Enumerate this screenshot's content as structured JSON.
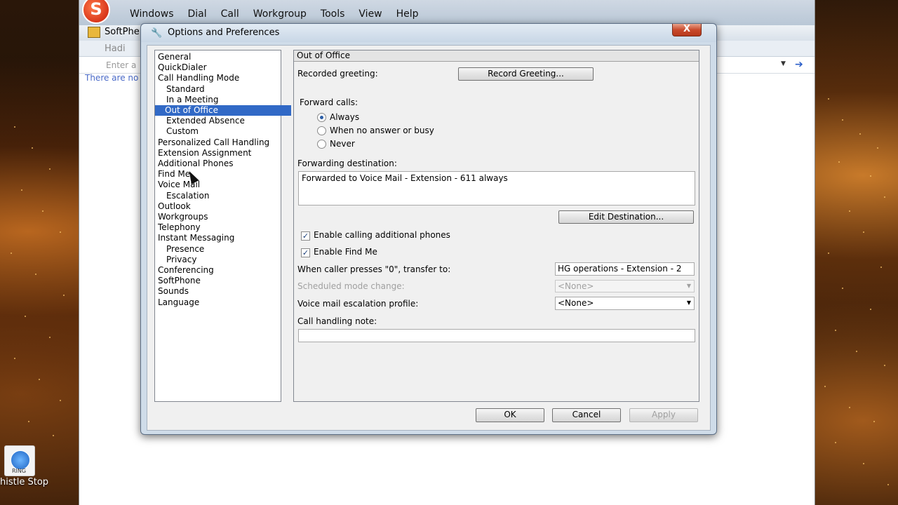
{
  "app": {
    "menu": [
      "Windows",
      "Dial",
      "Call",
      "Workgroup",
      "Tools",
      "View",
      "Help"
    ],
    "toolbar_label": "SoftPhe",
    "user_label": "Hadi",
    "search_placeholder": "Enter a",
    "status_text": "There are no"
  },
  "desktop": {
    "icon_caption": "RING",
    "icon_label": "histle Stop"
  },
  "dialog": {
    "title": "Options and Preferences",
    "close_label": "X",
    "nav": [
      {
        "label": "General"
      },
      {
        "label": "QuickDialer"
      },
      {
        "label": "Call Handling Mode"
      },
      {
        "label": "Standard",
        "sub": true
      },
      {
        "label": "In a Meeting",
        "sub": true
      },
      {
        "label": "Out of Office",
        "sub": true,
        "selected": true
      },
      {
        "label": "Extended Absence",
        "sub": true
      },
      {
        "label": "Custom",
        "sub": true
      },
      {
        "label": "Personalized Call Handling"
      },
      {
        "label": "Extension Assignment"
      },
      {
        "label": "Additional Phones"
      },
      {
        "label": "Find Me"
      },
      {
        "label": "Voice Mail"
      },
      {
        "label": "Escalation",
        "sub": true
      },
      {
        "label": "Outlook"
      },
      {
        "label": "Workgroups"
      },
      {
        "label": "Telephony"
      },
      {
        "label": "Instant Messaging"
      },
      {
        "label": "Presence",
        "sub": true
      },
      {
        "label": "Privacy",
        "sub": true
      },
      {
        "label": "Conferencing"
      },
      {
        "label": "SoftPhone"
      },
      {
        "label": "Sounds"
      },
      {
        "label": "Language"
      }
    ],
    "panel": {
      "header": "Out of Office",
      "recorded_greeting_label": "Recorded greeting:",
      "record_greeting_button": "Record Greeting...",
      "forward_calls_label": "Forward calls:",
      "forward_options": [
        "Always",
        "When no answer or busy",
        "Never"
      ],
      "forward_selected": "Always",
      "forwarding_destination_label": "Forwarding destination:",
      "forwarding_destination_value": "Forwarded to Voice Mail - Extension - 611 always",
      "edit_destination_button": "Edit Destination...",
      "enable_additional_phones_label": "Enable calling additional phones",
      "enable_additional_phones_checked": true,
      "enable_find_me_label": "Enable Find Me",
      "enable_find_me_checked": true,
      "caller_zero_label": "When caller presses \"0\", transfer to:",
      "caller_zero_value": "HG operations - Extension - 2",
      "scheduled_mode_label": "Scheduled mode change:",
      "scheduled_mode_value": "<None>",
      "vm_escalation_label": "Voice mail escalation profile:",
      "vm_escalation_value": "<None>",
      "call_handling_note_label": "Call handling note:",
      "call_handling_note_value": ""
    },
    "buttons": {
      "ok": "OK",
      "cancel": "Cancel",
      "apply": "Apply"
    }
  }
}
